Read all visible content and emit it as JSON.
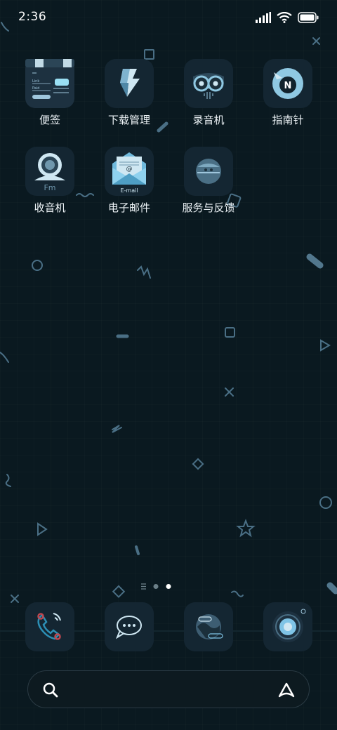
{
  "status_bar": {
    "time": "2:36",
    "icons": [
      "signal-icon",
      "wifi-icon",
      "battery-icon"
    ]
  },
  "apps": [
    {
      "label": "便签",
      "icon": "notes-icon",
      "icon_text": [
        "Link",
        "Paid"
      ]
    },
    {
      "label": "下载管理",
      "icon": "download-icon"
    },
    {
      "label": "录音机",
      "icon": "recorder-icon"
    },
    {
      "label": "指南针",
      "icon": "compass-icon",
      "icon_text": "N"
    },
    {
      "label": "收音机",
      "icon": "radio-icon",
      "icon_text": "Fm"
    },
    {
      "label": "电子邮件",
      "icon": "email-icon",
      "icon_text": [
        "@",
        "E-mail"
      ]
    },
    {
      "label": "服务与反馈",
      "icon": "service-icon"
    }
  ],
  "page_indicator": {
    "pages": 3,
    "current": 3
  },
  "dock": [
    {
      "icon": "phone-icon"
    },
    {
      "icon": "messages-icon"
    },
    {
      "icon": "browser-icon"
    },
    {
      "icon": "camera-icon"
    }
  ],
  "search_bar": {
    "search_icon": "search-icon",
    "assistant_icon": "assistant-icon"
  },
  "colors": {
    "background": "#0a1920",
    "tile": "#142632",
    "accent": "#7fc4e6",
    "deco": "#5a7f96"
  }
}
